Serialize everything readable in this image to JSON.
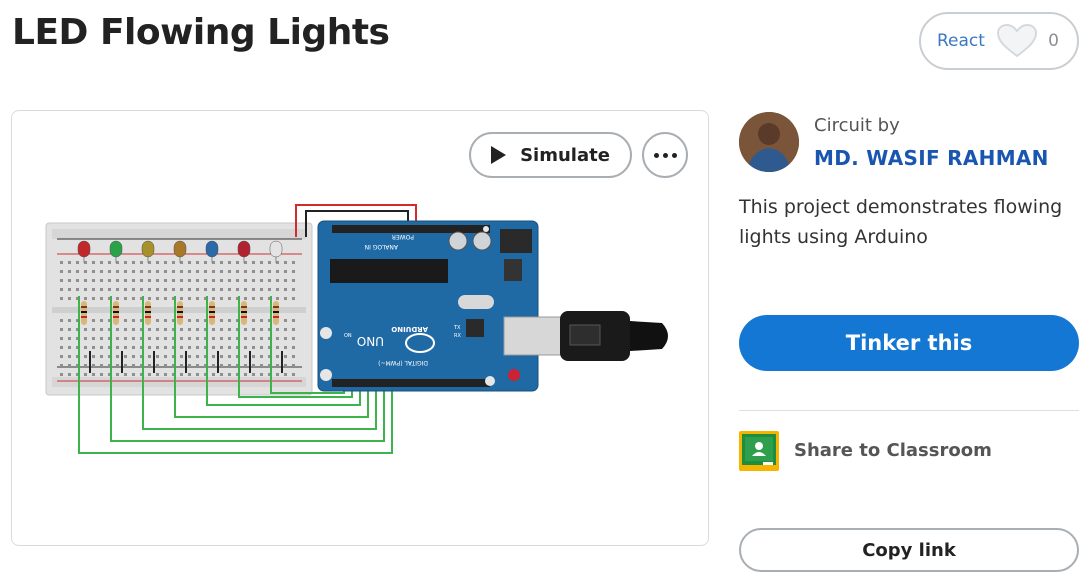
{
  "project": {
    "title": "LED Flowing Lights"
  },
  "react": {
    "label": "React",
    "count": "0"
  },
  "canvas": {
    "simulate_label": "Simulate"
  },
  "board_labels": {
    "brand": "ARDUINO",
    "model": "UNO",
    "digital": "DIGITAL (PWM~)",
    "power": "POWER",
    "analog": "ANALOG IN",
    "tx": "TX",
    "rx": "RX",
    "on": "ON"
  },
  "author": {
    "circuit_by": "Circuit by",
    "name": "MD. WASIF RAHMAN"
  },
  "description": "This project demonstrates flowing lights using Arduino",
  "actions": {
    "tinker_label": "Tinker this",
    "share_label": "Share to Classroom",
    "copy_label": "Copy link"
  },
  "colors": {
    "primary": "#1477d4",
    "author_link": "#1a56b0",
    "arduino_blue": "#1f6aa5",
    "wire_green": "#3cb44b",
    "wire_red": "#d42a2a",
    "classroom_green": "#1e8e3e",
    "classroom_yellow": "#f4b400"
  },
  "leds": [
    {
      "color": "red",
      "hex": "#c0282b"
    },
    {
      "color": "green",
      "hex": "#2aa24a"
    },
    {
      "color": "olive",
      "hex": "#a8902a"
    },
    {
      "color": "amber",
      "hex": "#a8782a"
    },
    {
      "color": "blue",
      "hex": "#2a6aa8"
    },
    {
      "color": "crimson",
      "hex": "#b02230"
    },
    {
      "color": "white",
      "hex": "#e4e4e4"
    }
  ]
}
